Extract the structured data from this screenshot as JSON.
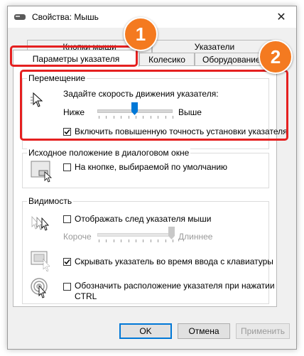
{
  "window": {
    "title": "Свойства: Мышь",
    "close_glyph": "✕"
  },
  "tabs": {
    "row_top": [
      "Кнопки мыши",
      "Указатели"
    ],
    "row_bottom": [
      "Параметры указателя",
      "Колесико",
      "Оборудование"
    ],
    "active": "Параметры указателя"
  },
  "motion": {
    "legend": "Перемещение",
    "speed_label": "Задайте скорость движения указателя:",
    "slow_label": "Ниже",
    "fast_label": "Выше",
    "speed_level": 0.5,
    "precision_label": "Включить повышенную точность установки указателя",
    "precision_checked": true
  },
  "snap": {
    "legend": "Исходное положение в диалоговом окне",
    "label": "На кнопке, выбираемой по умолчанию",
    "checked": false
  },
  "visibility": {
    "legend": "Видимость",
    "trails_label": "Отображать след указателя мыши",
    "trails_checked": false,
    "trails_short": "Короче",
    "trails_long": "Длиннее",
    "trails_level": 1.0,
    "hide_label": "Скрывать указатель во время ввода с клавиатуры",
    "hide_checked": true,
    "ctrl_label_line1": "Обозначить расположение указателя при нажатии",
    "ctrl_label_line2": "CTRL",
    "ctrl_checked": false
  },
  "buttons": {
    "ok": "OK",
    "cancel": "Отмена",
    "apply": "Применить"
  },
  "annotations": {
    "badge_1": "1",
    "badge_2": "2",
    "highlight_color": "#e52020",
    "badge_color": "#f47a20"
  }
}
